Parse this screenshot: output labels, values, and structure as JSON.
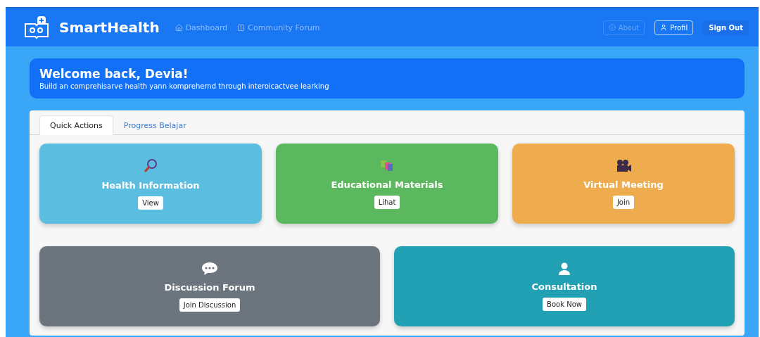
{
  "navbar": {
    "brand": "SmartHealth",
    "links": [
      {
        "label": "Dashboard"
      },
      {
        "label": "Community Forum"
      }
    ],
    "actions": [
      {
        "label": "About",
        "kind": "faded"
      },
      {
        "label": "Profil",
        "kind": "outline"
      },
      {
        "label": "Sign Out",
        "kind": "solid"
      }
    ]
  },
  "welcome": {
    "title": "Welcome back, Devia!",
    "subtitle": "Build an comprehisarve health yann komprehernd through interoicactvee learking"
  },
  "tabs": [
    {
      "label": "Quick Actions",
      "selected": true
    },
    {
      "label": "Progress Belajar",
      "selected": false
    }
  ],
  "cards": [
    {
      "title": "Health Information",
      "button": "View",
      "color": "#5bbde0"
    },
    {
      "title": "Educational Materials",
      "button": "Lihat",
      "color": "#5cb85f"
    },
    {
      "title": "Virtual Meeting",
      "button": "Join",
      "color": "#eeac4e"
    },
    {
      "title": "Discussion Forum",
      "button": "Join Discussion",
      "color": "#6c747d"
    },
    {
      "title": "Consultation",
      "button": "Book Now",
      "color": "#21a1b3"
    }
  ]
}
